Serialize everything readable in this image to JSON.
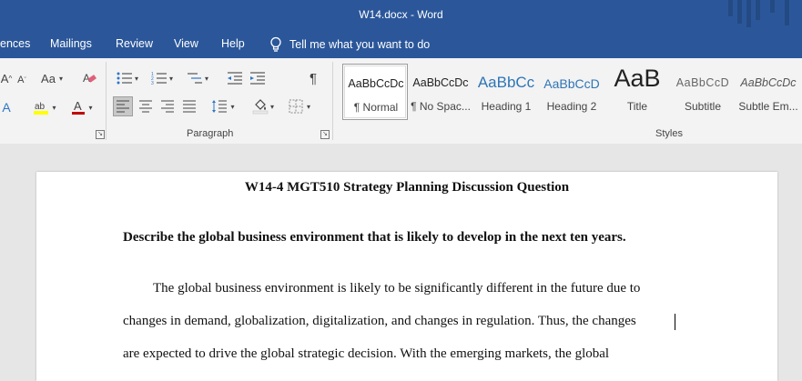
{
  "window": {
    "title": "W14.docx  -  Word"
  },
  "tabs": [
    "ences",
    "Mailings",
    "Review",
    "View",
    "Help"
  ],
  "tellme": {
    "text": "Tell me what you want to do"
  },
  "ribbon": {
    "font_group": {
      "aa_label": "Aa"
    },
    "paragraph_group": {
      "label": "Paragraph"
    },
    "styles_group": {
      "label": "Styles",
      "items": [
        {
          "preview": "AaBbCcDc",
          "name": "¶ Normal"
        },
        {
          "preview": "AaBbCcDc",
          "name": "¶ No Spac..."
        },
        {
          "preview": "AaBbCc",
          "name": "Heading 1"
        },
        {
          "preview": "AaBbCcD",
          "name": "Heading 2"
        },
        {
          "preview": "AaB",
          "name": "Title"
        },
        {
          "preview": "AaBbCcD",
          "name": "Subtitle"
        },
        {
          "preview": "AaBbCcDc",
          "name": "Subtle Em..."
        }
      ]
    }
  },
  "document": {
    "title": "W14-4 MGT510 Strategy Planning Discussion Question",
    "question": "Describe the global business environment that is likely to develop in the next ten years.",
    "body_lines": [
      "The global business environment is likely to be significantly different in the future due to",
      "changes in demand, globalization, digitalization, and changes in regulation. Thus, the changes",
      "are expected to drive the global strategic decision. With the emerging markets, the global"
    ]
  },
  "colors": {
    "word_blue": "#2b579a",
    "ribbon_bg": "#f3f3f3",
    "canvas_bg": "#e6e6e6"
  }
}
